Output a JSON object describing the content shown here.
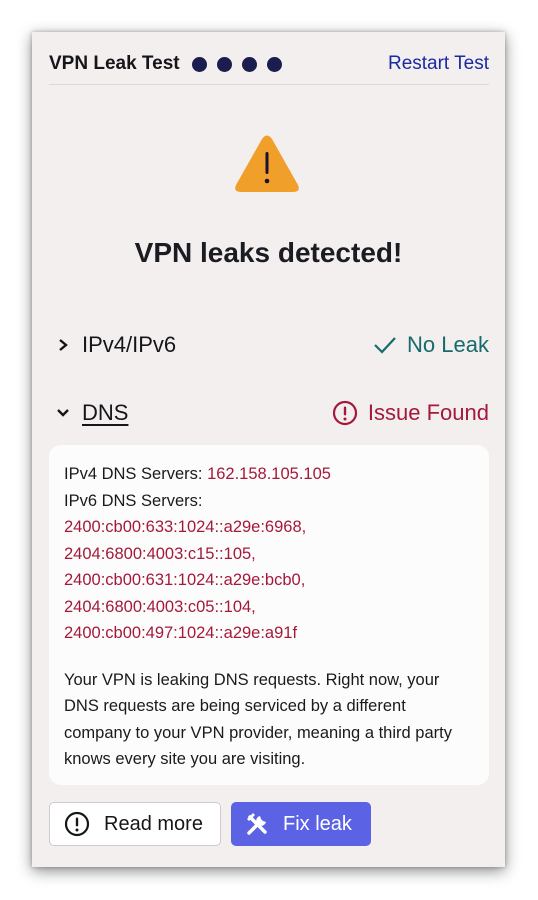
{
  "header": {
    "title": "VPN Leak Test",
    "progress_dots": 4,
    "restart_label": "Restart Test"
  },
  "alert": {
    "icon": "warning-triangle-icon",
    "headline": "VPN leaks detected!"
  },
  "tests": [
    {
      "label": "IPv4/IPv6",
      "expanded": false,
      "status": "No Leak",
      "status_icon": "checkmark-icon",
      "status_color": "#176b6b"
    },
    {
      "label": "DNS",
      "expanded": true,
      "status": "Issue Found",
      "status_icon": "exclamation-circle-icon",
      "status_color": "#a4193a"
    }
  ],
  "dns_details": {
    "ipv4_label": "IPv4 DNS Servers:",
    "ipv4_value": "162.158.105.105",
    "ipv6_label": "IPv6 DNS Servers:",
    "ipv6_values": [
      "2400:cb00:633:1024::a29e:6968,",
      "2404:6800:4003:c15::105,",
      "2400:cb00:631:1024::a29e:bcb0,",
      "2404:6800:4003:c05::104,",
      "2400:cb00:497:1024::a29e:a91f"
    ],
    "description": "Your VPN is leaking DNS requests. Right now, your DNS requests are being serviced by a different company to your VPN provider, meaning a third party knows every site you are visiting."
  },
  "actions": {
    "read_more_label": "Read more",
    "fix_leak_label": "Fix leak"
  },
  "colors": {
    "accent": "#5b62e4",
    "link": "#1a2aa0",
    "success": "#176b6b",
    "danger": "#a4193a",
    "warning": "#f0a02a"
  }
}
